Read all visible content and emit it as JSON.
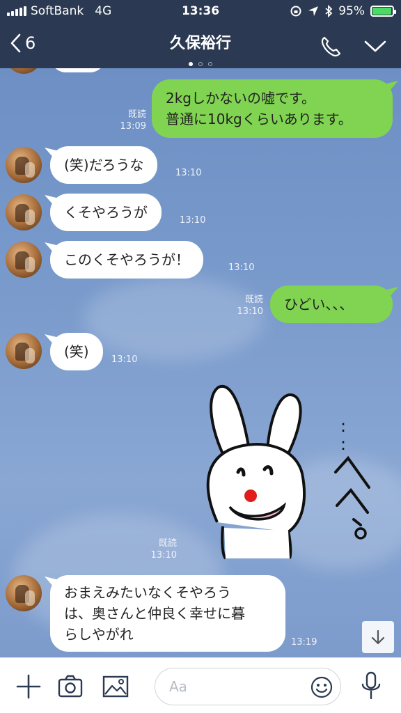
{
  "status": {
    "carrier": "SoftBank",
    "network": "4G",
    "time": "13:36",
    "battery": "95%",
    "battery_level": 0.95
  },
  "header": {
    "back_count": "6",
    "title": "久保裕行"
  },
  "messages": [
    {
      "id": "m1",
      "side": "out",
      "lines": [
        "2kgしかないの嘘です。",
        "普通に10kgくらいあります。"
      ],
      "read": "既読",
      "time": "13:09"
    },
    {
      "id": "m2",
      "side": "in",
      "text": "(笑)だろうな",
      "time": "13:10"
    },
    {
      "id": "m3",
      "side": "in",
      "text": "くそやろうが",
      "time": "13:10"
    },
    {
      "id": "m4",
      "side": "in",
      "text": "このくそやろうが！",
      "time": "13:10"
    },
    {
      "id": "m5",
      "side": "out",
      "text": "ひどい、、、",
      "read": "既読",
      "time": "13:10"
    },
    {
      "id": "m6",
      "side": "in",
      "text": "(笑)",
      "time": "13:10"
    },
    {
      "id": "m7",
      "side": "out",
      "sticker": "rabbit-sticker",
      "sticker_text": "…へへっ。",
      "read": "既読",
      "time": "13:10"
    },
    {
      "id": "m8",
      "side": "in",
      "lines": [
        "おまえみたいなくそやろう",
        "は、奥さんと仲良く幸せに暮",
        "らしやがれ"
      ],
      "time": "13:19"
    }
  ],
  "composer": {
    "placeholder": "Aa"
  },
  "colors": {
    "header": "#2b3a52",
    "outgoing": "#80d451",
    "incoming": "#ffffff",
    "background": "#7494c6"
  }
}
